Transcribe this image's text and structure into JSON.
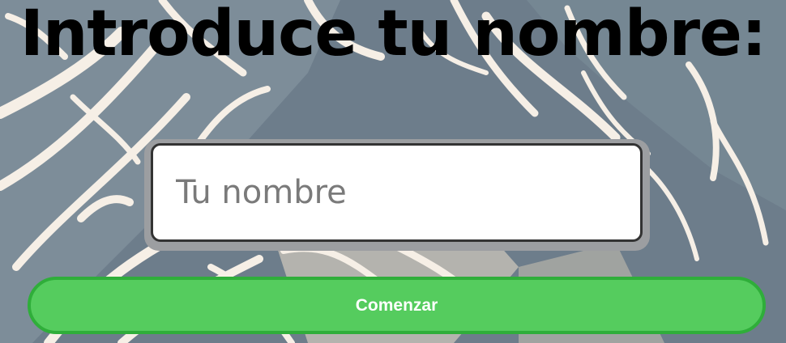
{
  "page": {
    "title": "Introduce tu nombre:"
  },
  "form": {
    "name_placeholder": "Tu nombre",
    "name_value": "",
    "start_label": "Comenzar"
  },
  "colors": {
    "background": "#6f7f8d",
    "pattern": "#f6efe6",
    "button": "#55cc5e",
    "button_border": "#2fae3a"
  }
}
